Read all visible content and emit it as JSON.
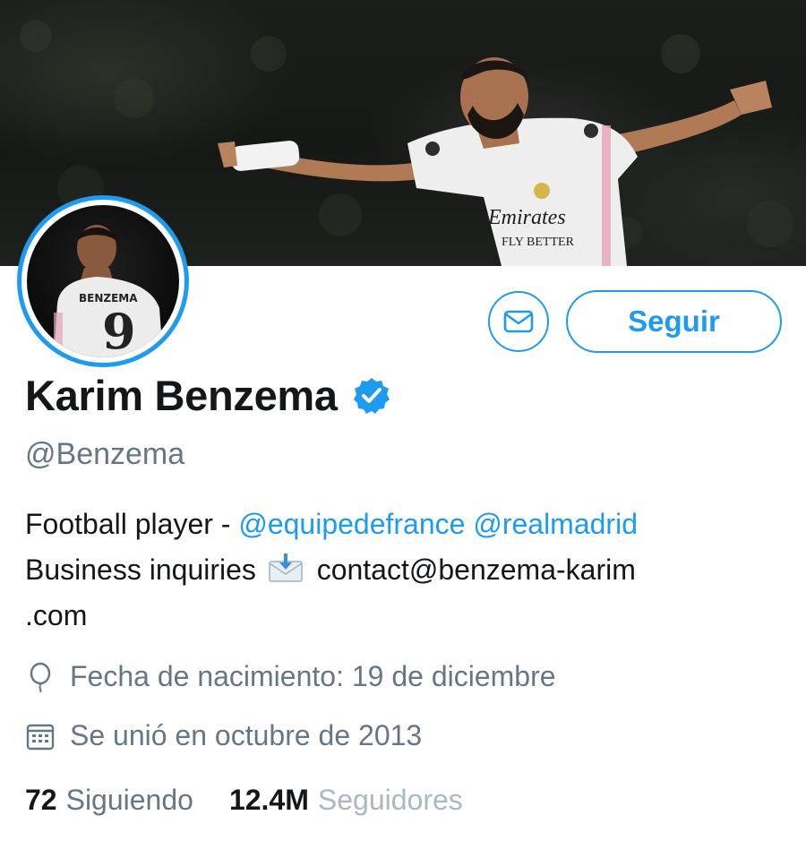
{
  "profile": {
    "display_name": "Karim Benzema",
    "handle": "@Benzema",
    "verified": true,
    "bio": {
      "line1_prefix": "Football player - ",
      "mention1": "@equipedefrance",
      "mention2": "@realmadrid",
      "line2_prefix": "Business inquiries",
      "envelope_emoji": "envelope-arrow-icon",
      "email_part1": "contact@benzema-karim",
      "email_part2": ".com"
    },
    "birthdate": "Fecha de nacimiento: 19 de diciembre",
    "joined": "Se unió en octubre de 2013"
  },
  "banner": {
    "jersey_sponsor_line1": "Emirates",
    "jersey_sponsor_line2": "FLY BETTER"
  },
  "avatar": {
    "jersey_name": "BENZEMA",
    "jersey_number": "9"
  },
  "actions": {
    "message_icon": "envelope-icon",
    "follow_label": "Seguir"
  },
  "stats": {
    "following_count": "72",
    "following_label": "Siguiendo",
    "followers_count": "12.4M",
    "followers_label": "Seguidores"
  },
  "colors": {
    "accent": "#1d9bf0",
    "text": "#14171a",
    "secondary": "#657786"
  }
}
